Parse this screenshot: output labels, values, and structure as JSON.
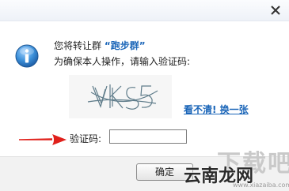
{
  "dialog": {
    "message_prefix": "您将转让群 ",
    "group_name": "“跑步群”",
    "instruction": "为确保本人操作，请输入验证码:",
    "captcha_text": "VkS5",
    "refresh_link": "看不清! 换一张",
    "code_label": "验证码:",
    "code_value": "",
    "ok_label": "确定"
  },
  "watermark": {
    "big": "下载吧",
    "mid": "云南龙网",
    "url": "www.xiazaiba.com"
  },
  "colors": {
    "link": "#1a65b8",
    "arrow": "#e0201b",
    "info_icon": "#3b8fd8"
  },
  "icons": {
    "close": "close-icon",
    "info": "info-icon",
    "arrow": "arrow-right-icon"
  }
}
